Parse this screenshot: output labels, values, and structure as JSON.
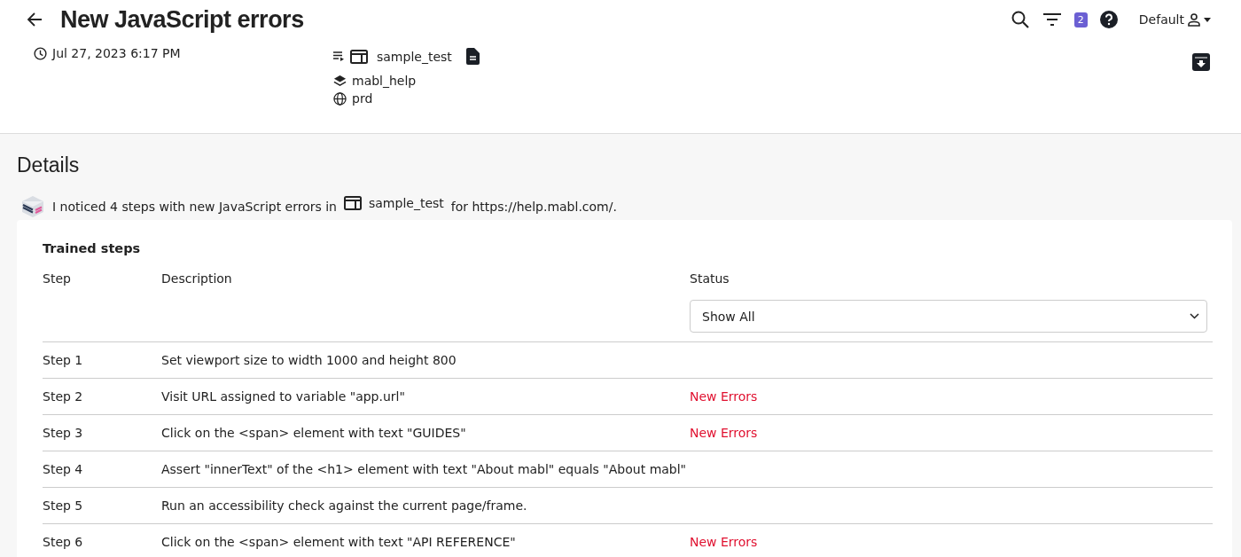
{
  "header": {
    "title": "New JavaScript errors",
    "timestamp": "Jul 27, 2023 6:17 PM",
    "test_name": "sample_test",
    "workspace": "mabl_help",
    "environment": "prd",
    "badge_count": "2",
    "user_menu": "Default"
  },
  "details": {
    "heading": "Details",
    "message_before": "I noticed 4 steps with new JavaScript errors in",
    "message_test": "sample_test",
    "message_after": "for https://help.mabl.com/."
  },
  "trained_steps": {
    "title": "Trained steps",
    "columns": [
      "Step",
      "Description",
      "Status"
    ],
    "status_filter": "Show All",
    "rows": [
      {
        "step": "Step 1",
        "description": "Set viewport size to width 1000 and height 800"
      },
      {
        "step": "Step 2",
        "description": "Visit URL assigned to variable \"app.url\"",
        "status": "New Errors"
      },
      {
        "step": "Step 3",
        "description": "Click on the <span> element with text \"GUIDES\"",
        "status": "New Errors"
      },
      {
        "step": "Step 4",
        "description": "Assert \"innerText\" of the <h1> element with text \"About mabl\" equals \"About mabl\""
      },
      {
        "step": "Step 5",
        "description": "Run an accessibility check against the current page/frame."
      },
      {
        "step": "Step 6",
        "description": "Click on the <span> element with text \"API REFERENCE\"",
        "status": "New Errors"
      }
    ]
  }
}
